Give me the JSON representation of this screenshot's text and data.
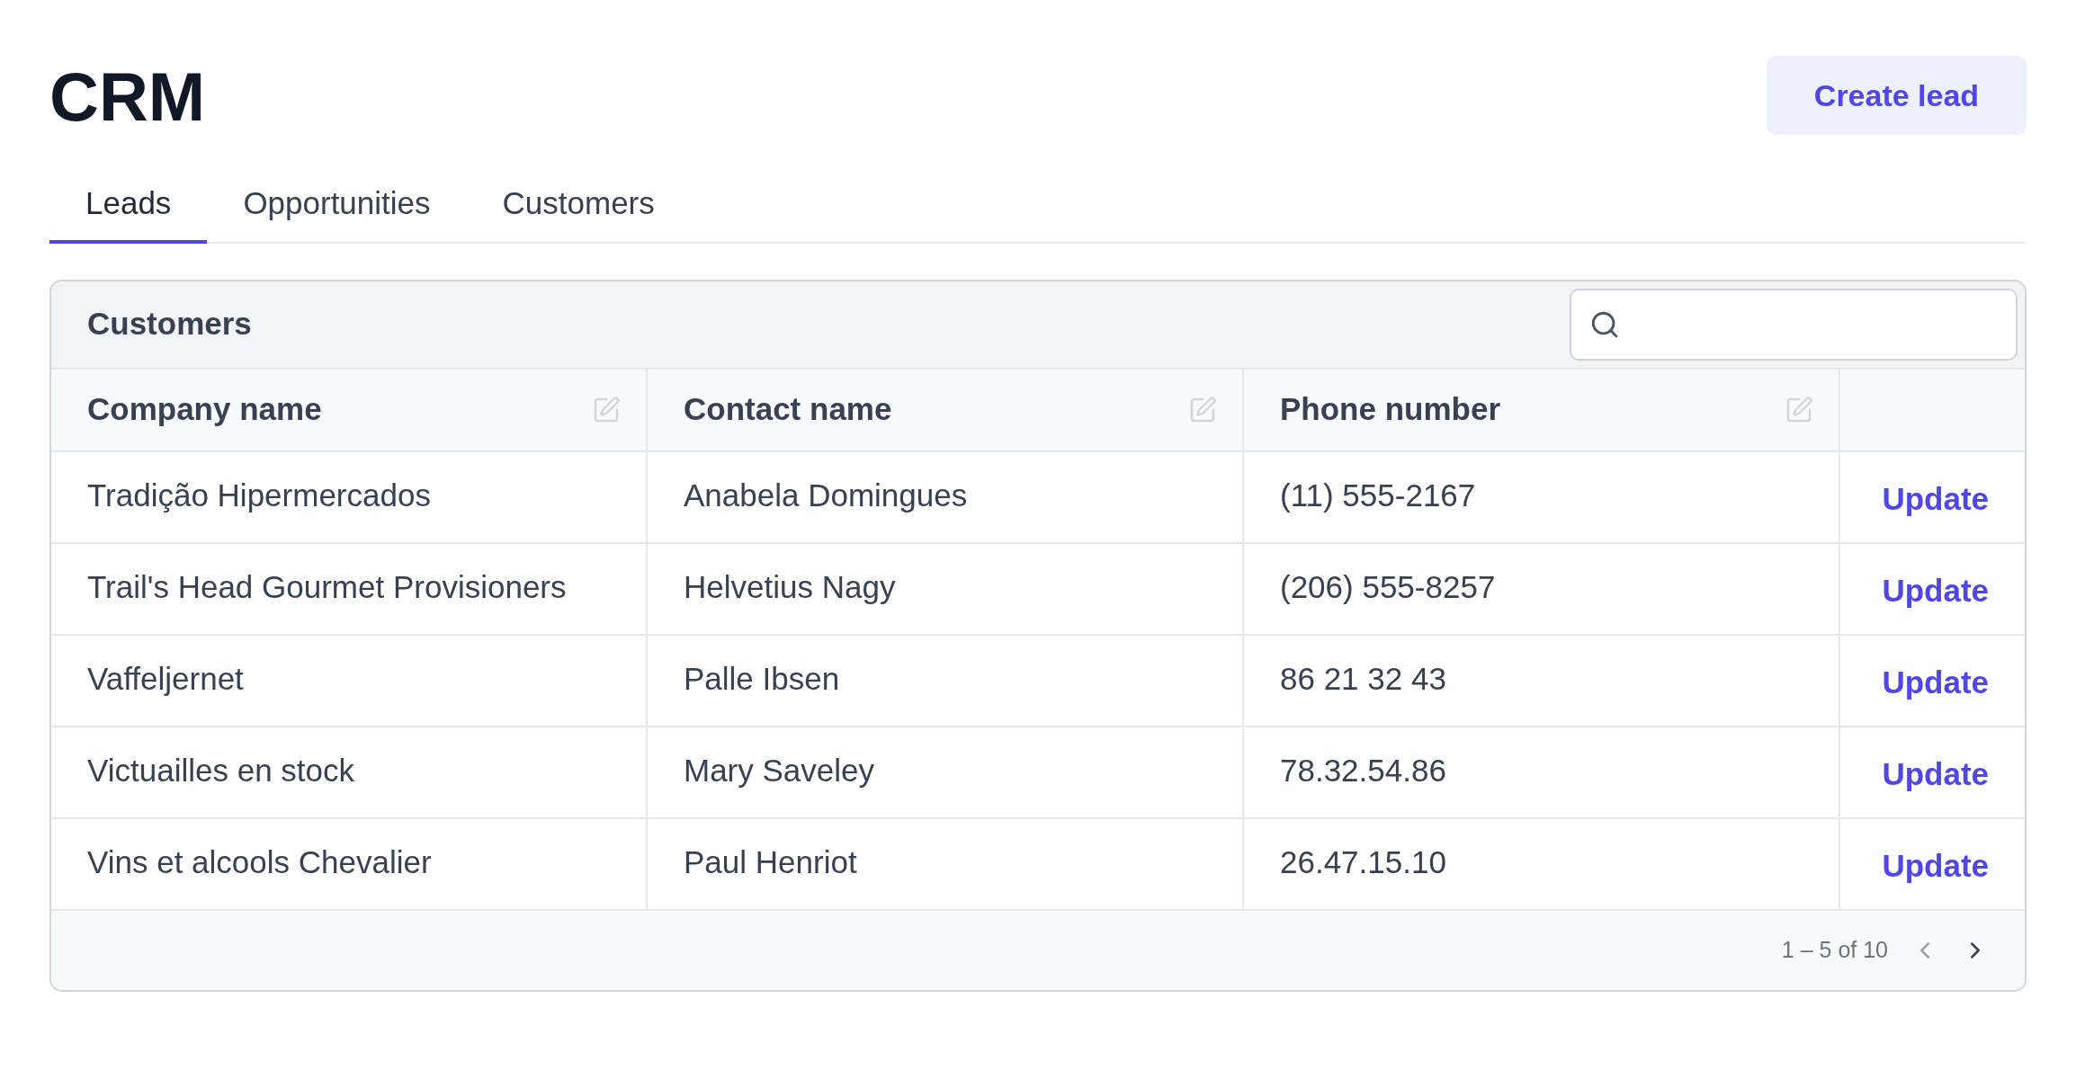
{
  "title": "CRM",
  "create_button": "Create lead",
  "tabs": [
    {
      "label": "Leads",
      "selected": true
    },
    {
      "label": "Opportunities",
      "selected": false
    },
    {
      "label": "Customers",
      "selected": false
    }
  ],
  "table": {
    "title": "Customers",
    "columns": [
      "Company name",
      "Contact name",
      "Phone number"
    ],
    "rows": [
      {
        "cells": [
          "Tradição Hipermercados",
          "Anabela Domingues",
          "(11) 555-2167"
        ],
        "action": "Update"
      },
      {
        "cells": [
          "Trail's Head Gourmet Provisioners",
          "Helvetius Nagy",
          "(206) 555-8257"
        ],
        "action": "Update"
      },
      {
        "cells": [
          "Vaffeljernet",
          "Palle Ibsen",
          "86 21 32 43"
        ],
        "action": "Update"
      },
      {
        "cells": [
          "Victuailles en stock",
          "Mary Saveley",
          "78.32.54.86"
        ],
        "action": "Update"
      },
      {
        "cells": [
          "Vins et alcools Chevalier",
          "Paul Henriot",
          "26.47.15.10"
        ],
        "action": "Update"
      }
    ],
    "pagination": {
      "range": "1 – 5 of 10",
      "prev_disabled": true,
      "next_disabled": false
    }
  }
}
